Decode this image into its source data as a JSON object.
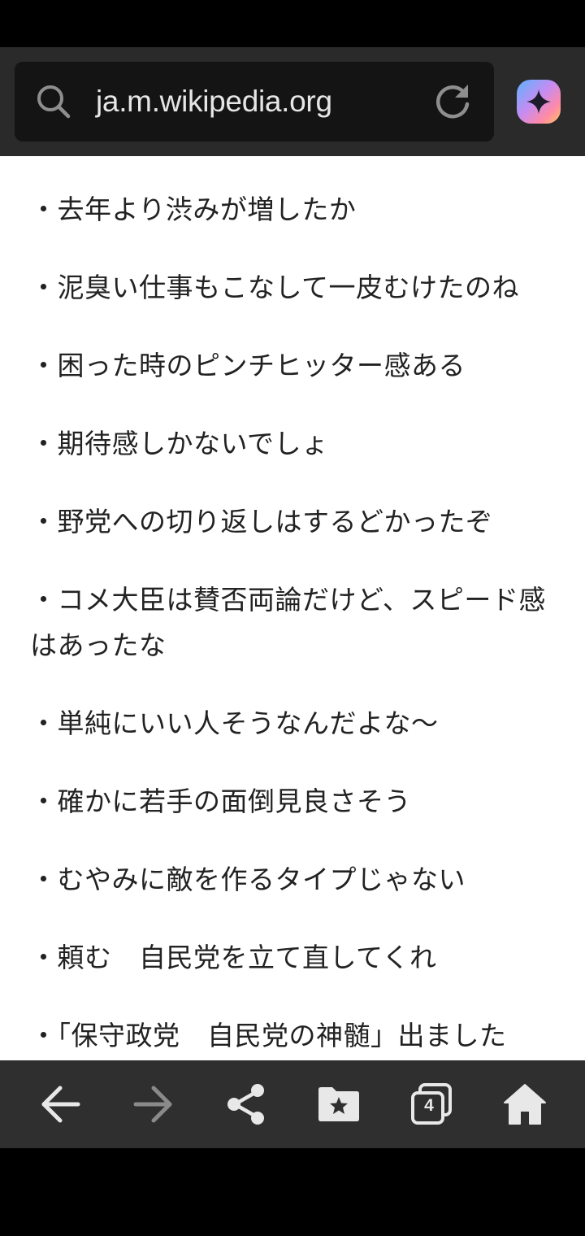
{
  "browser": {
    "url": "ja.m.wikipedia.org",
    "tab_count": "4"
  },
  "content": {
    "items": [
      "・去年より渋みが増したか",
      "・泥臭い仕事もこなして一皮むけたのね",
      "・困った時のピンチヒッター感ある",
      "・期待感しかないでしょ",
      "・野党への切り返しはするどかったぞ",
      "・コメ大臣は賛否両論だけど、スピード感はあったな",
      "・単純にいい人そうなんだよな〜",
      "・確かに若手の面倒見良さそう",
      "・むやみに敵を作るタイプじゃない",
      "・頼む　自民党を立て直してくれ",
      "・「保守政党　自民党の神髄」出ました"
    ]
  },
  "icons": {
    "search": "search-icon",
    "reload": "reload-icon",
    "assistant": "assistant-icon",
    "back": "back-arrow-icon",
    "forward": "forward-arrow-icon",
    "share": "share-icon",
    "bookmarks": "bookmark-folder-icon",
    "tabs": "tabs-icon",
    "home": "home-icon"
  },
  "colors": {
    "header_bg": "#2a2a2a",
    "url_bar_bg": "#141414",
    "toolbar_bg": "#2f2f2f",
    "icon_active": "#e8e8e8",
    "icon_disabled": "#8a8a8a"
  }
}
